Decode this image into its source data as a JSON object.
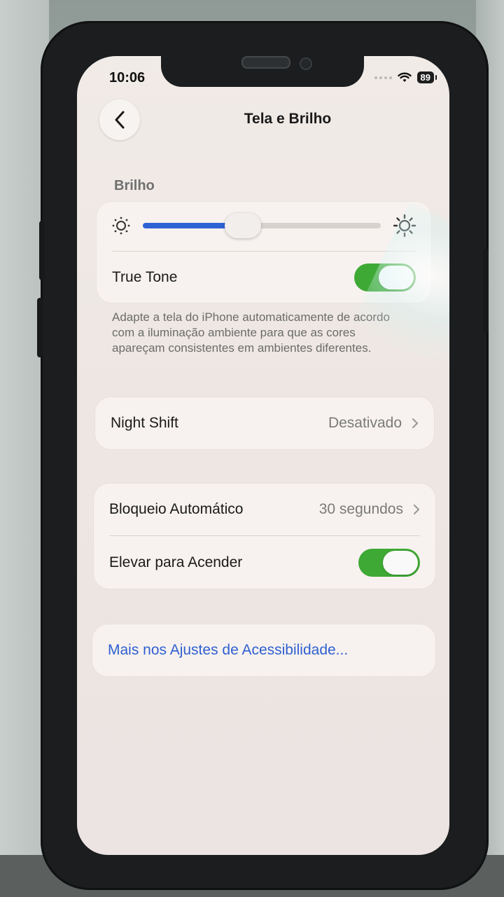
{
  "status_bar": {
    "time": "10:06",
    "battery": "89",
    "icons": [
      "signal-dots-icon",
      "wifi-icon",
      "battery-icon"
    ]
  },
  "nav": {
    "back_icon": "chevron-left-icon",
    "title": "Tela e Brilho"
  },
  "brightness": {
    "section_label": "Brilho",
    "slider_level": 0.42,
    "min_icon": "sun-small-icon",
    "max_icon": "sun-large-icon",
    "true_tone_label": "True Tone",
    "true_tone_on": true,
    "footnote": "Adapte a tela do iPhone automaticamente de acordo com a iluminação ambiente para que as cores apareçam consistentes em ambientes diferentes."
  },
  "night_shift": {
    "label": "Night Shift",
    "value": "Desativado"
  },
  "lock": {
    "auto_lock_label": "Bloqueio Automático",
    "auto_lock_value": "30 segundos",
    "raise_to_wake_label": "Elevar para Acender",
    "raise_to_wake_on": true
  },
  "accessibility_link": "Mais nos Ajustes de Acessibilidade...",
  "colors": {
    "accent_blue": "#2e63d6",
    "toggle_green": "#3fa935",
    "link_blue": "#2f5fd0"
  }
}
